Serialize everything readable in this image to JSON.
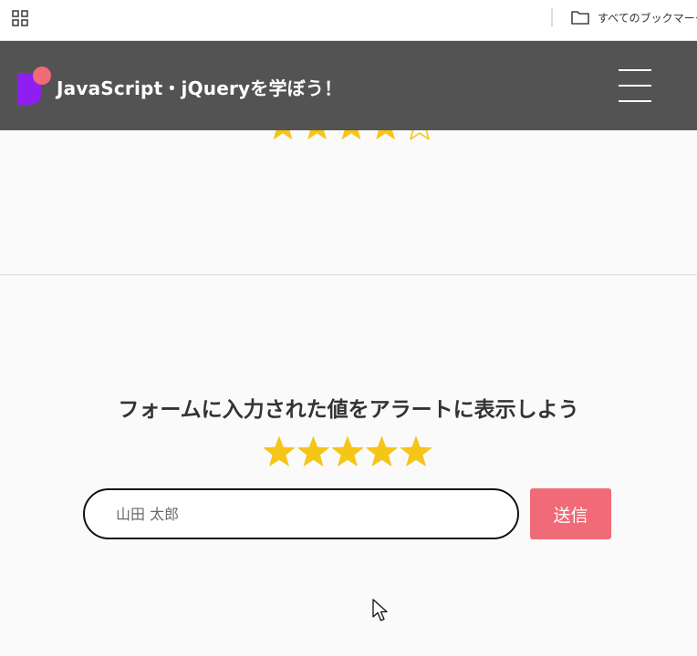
{
  "browser": {
    "bookmark_folder_label": "すべてのブックマーク",
    "icons": [
      "apps-grid-icon",
      "folder-icon"
    ]
  },
  "header": {
    "title": "JavaScript・jQueryを学ぼう！",
    "menu_icon": "hamburger-icon"
  },
  "previous_section": {
    "rating": 4,
    "max_rating": 5
  },
  "form_section": {
    "heading": "フォームに入力された値をアラートに表示しよう",
    "rating": 5,
    "max_rating": 5,
    "input_placeholder": "山田 太郎",
    "submit_label": "送信"
  },
  "colors": {
    "header_bg": "#535353",
    "star": "#f5c518",
    "submit_bg": "#f06a78",
    "logo_purple": "#8f1ff0",
    "logo_pink": "#f06a78"
  }
}
